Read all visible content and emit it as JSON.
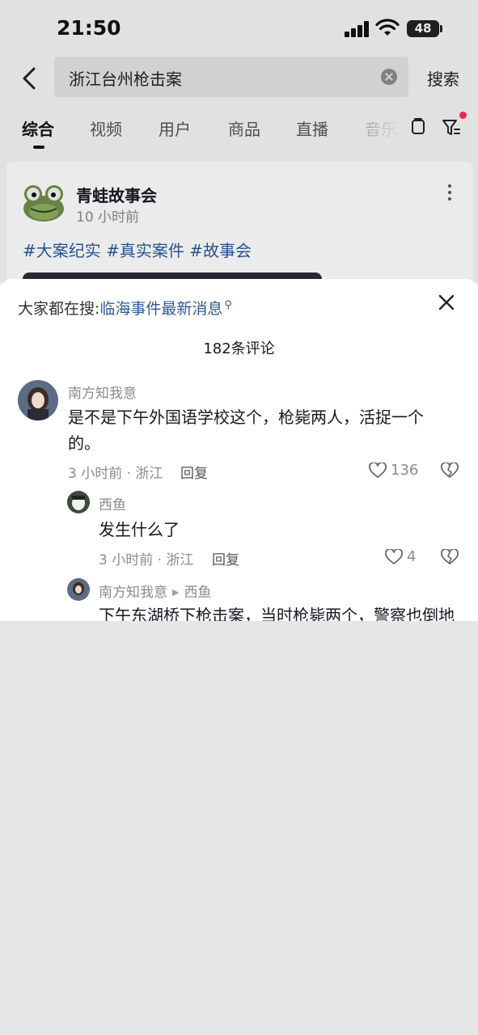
{
  "status_bar": {
    "time": "21:50",
    "battery": "48"
  },
  "search": {
    "query": "浙江台州枪击案",
    "button": "搜索"
  },
  "tabs": [
    {
      "label": "综合",
      "active": true
    },
    {
      "label": "视频"
    },
    {
      "label": "用户"
    },
    {
      "label": "商品"
    },
    {
      "label": "直播"
    },
    {
      "label": "音乐"
    }
  ],
  "video_card": {
    "author": "青蛙故事会",
    "time": "10 小时前",
    "tags": "#大案纪实 #真实案件 #故事会"
  },
  "comments_sheet": {
    "hot_search_label": "大家都在搜:",
    "hot_search_link": "临海事件最新消息",
    "comment_count": "182条评论",
    "comments": [
      {
        "user": "南方知我意",
        "text": "是不是下午外国语学校这个，枪毙两人，活捉一个的。",
        "meta": "3 小时前 · 浙江",
        "reply_label": "回复",
        "likes": "136"
      },
      {
        "user": "西鱼",
        "text": "发生什么了",
        "meta": "3 小时前 · 浙江",
        "reply_label": "回复",
        "likes": "4"
      },
      {
        "user": "南方知我意",
        "reply_to": "西鱼",
        "text": "下午东湖桥下枪击案，当时枪毙两个，警察也倒地"
      }
    ]
  },
  "colors": {
    "link": "#2a5a9c",
    "notification_dot": "#fe2c55",
    "muted_text": "#8a8b91"
  }
}
